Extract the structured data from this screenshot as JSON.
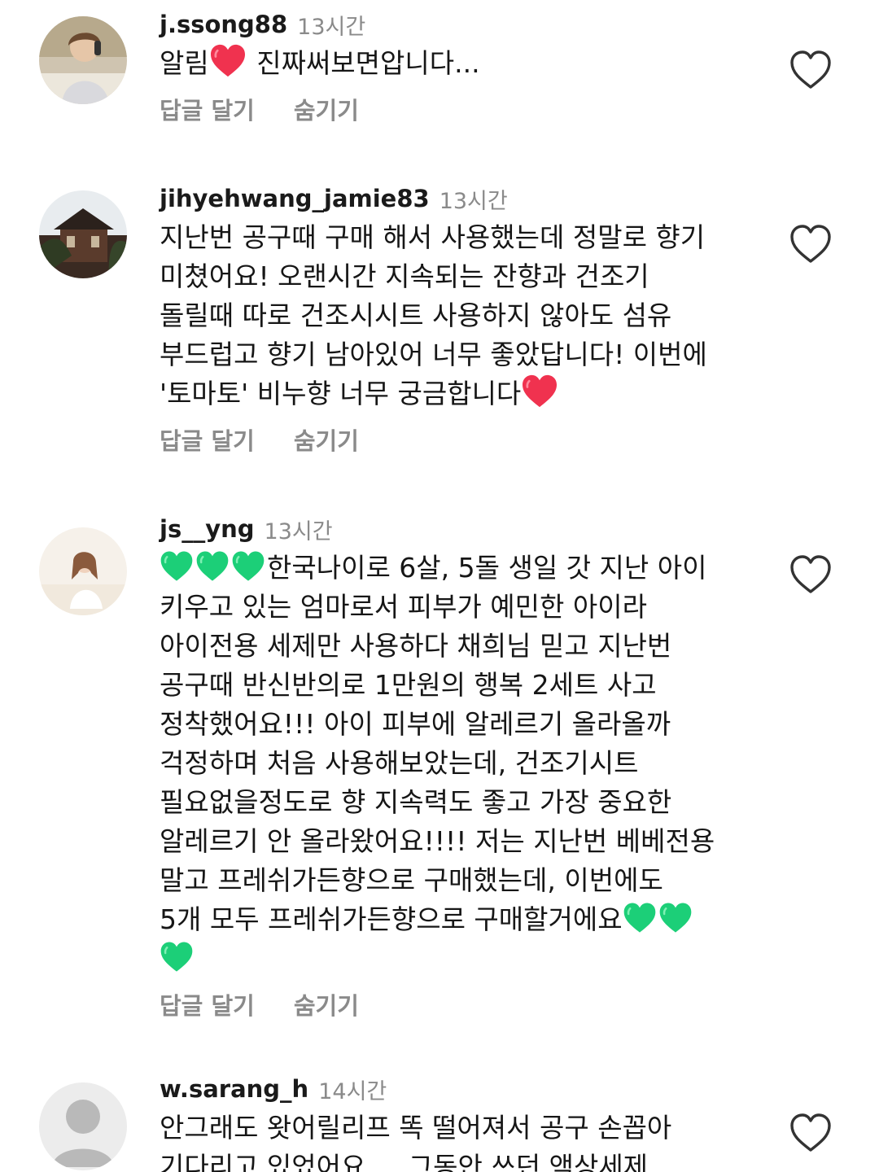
{
  "comments": [
    {
      "username": "j.ssong88",
      "time": "13시간",
      "lines": [
        {
          "before": "알림",
          "after": " 진짜써보면압니다..."
        }
      ],
      "reply_label": "답글 달기",
      "hide_label": "숨기기"
    },
    {
      "username": "jihyehwang_jamie83",
      "time": "13시간",
      "lines": [
        {
          "text": "지난번 공구때 구매 해서 사용했는데 정말로 향기"
        },
        {
          "text": "미쳤어요! 오랜시간 지속되는 잔향과 건조기"
        },
        {
          "text": "돌릴때 따로 건조시시트 사용하지 않아도 섬유"
        },
        {
          "text": "부드럽고 향기 남아있어 너무 좋았답니다! 이번에"
        },
        {
          "before": "'토마토' 비누향 너무 궁금합니다"
        }
      ],
      "reply_label": "답글 달기",
      "hide_label": "숨기기"
    },
    {
      "username": "js__yng",
      "time": "13시간",
      "lines": [
        {
          "after": "한국나이로 6살, 5돌 생일 갓 지난 아이"
        },
        {
          "text": "키우고 있는 엄마로서 피부가 예민한 아이라"
        },
        {
          "text": "아이전용 세제만 사용하다 채희님 믿고 지난번"
        },
        {
          "text": "공구때 반신반의로 1만원의 행복 2세트 사고"
        },
        {
          "text": "정착했어요!!! 아이 피부에 알레르기 올라올까"
        },
        {
          "text": "걱정하며 처음 사용해보았는데, 건조기시트"
        },
        {
          "text": "필요없을정도로 향 지속력도 좋고 가장 중요한"
        },
        {
          "text": "알레르기 안 올라왔어요!!!! 저는 지난번 베베전용"
        },
        {
          "text": "말고 프레쉬가든향으로 구매했는데, 이번에도"
        },
        {
          "before": "5개 모두 프레쉬가든향으로 구매할거에요"
        }
      ],
      "reply_label": "답글 달기",
      "hide_label": "숨기기"
    },
    {
      "username": "w.sarang_h",
      "time": "14시간",
      "lines": [
        {
          "text": "안그래도 왓어릴리프 똑 떨어져서 공구 손꼽아"
        },
        {
          "text": "기다리고 있었어요 ... 그동안 쓰던 액상세제"
        }
      ]
    }
  ],
  "icons": {
    "like": "heart-outline-icon",
    "red_heart": "red-heart-emoji",
    "green_heart": "green-heart-emoji",
    "default_avatar": "default-avatar-icon"
  },
  "colors": {
    "red_heart": "#f0324f",
    "green_heart": "#1ccf78",
    "muted_text": "#8a8a8a",
    "icon_stroke": "#333333"
  }
}
